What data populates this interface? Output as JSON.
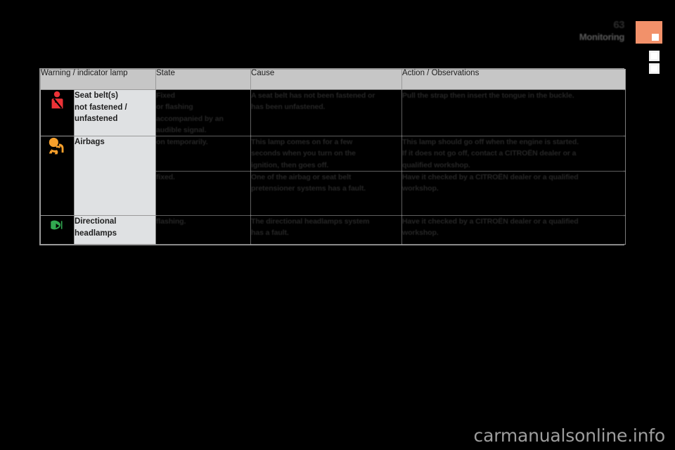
{
  "header": {
    "page_number": "63",
    "section_title": "Monitoring"
  },
  "table": {
    "columns": [
      "Warning / indicator lamp",
      "State",
      "Cause",
      "Action / Observations"
    ],
    "rows": [
      {
        "icon": "seat-belt-unfastened-icon",
        "icon_color": "#ed3237",
        "lamp": "Seat belt(s)\nnot fastened /\nunfastened",
        "state": "Fixed\nor flashing\naccompanied by an\naudible signal.",
        "cause": "A seat belt has not been fastened or\nhas been unfastened.",
        "action": "Pull the strap then insert the tongue in the buckle."
      },
      {
        "icon": "airbag-icon",
        "icon_color": "#f7a02c",
        "lamp": "Airbags",
        "state": "on temporarily.",
        "cause": "This lamp comes on for a few\nseconds when you turn on the\nignition, then goes off.",
        "action": "This lamp should go off when the engine is started.\nIf it does not go off, contact a CITROËN dealer or a\nqualified workshop."
      },
      {
        "icon": "",
        "icon_color": "",
        "lamp": "",
        "state": "fixed.",
        "cause": "One of the airbag or seat belt\npretensioner systems has a fault.",
        "action": "Have it checked by a CITROËN dealer or a qualified\nworkshop."
      },
      {
        "icon": "directional-headlamps-icon",
        "icon_color": "#31a850",
        "lamp": "Directional\nheadlamps",
        "state": "flashing.",
        "cause": "The directional headlamps system\nhas a fault.",
        "action": "Have it checked by a CITROËN dealer or a qualified\nworkshop."
      }
    ]
  },
  "watermark": {
    "text": "carmanualsonline.info"
  },
  "colors": {
    "header_band": "#c6c6c6",
    "lamp_cell": "#dfe1e3",
    "tab_orange": "#f2916a",
    "page_background": "#000000"
  }
}
